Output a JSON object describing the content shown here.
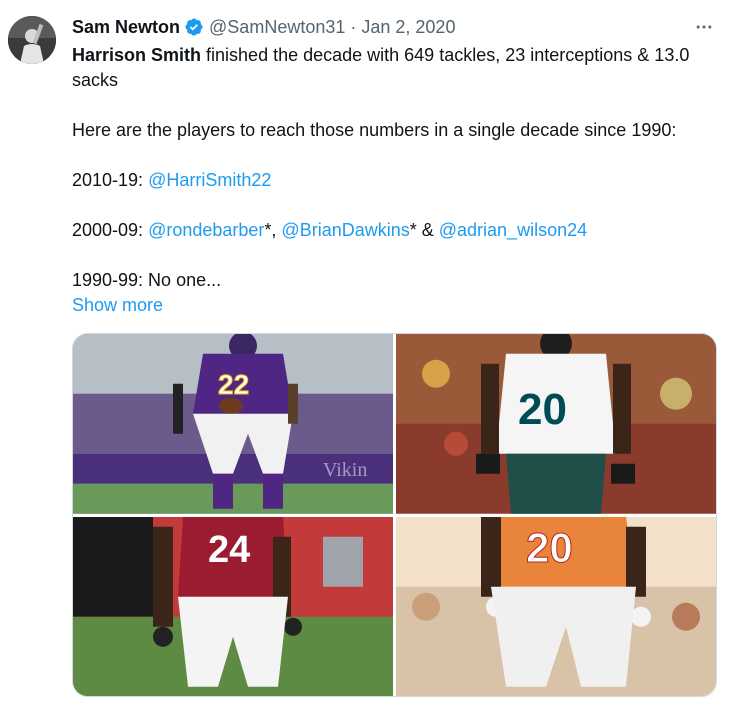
{
  "author": {
    "display_name": "Sam Newton",
    "handle": "@SamNewton31",
    "separator": "·",
    "date": "Jan 2, 2020",
    "verified_icon": "verified-badge-icon"
  },
  "menu_icon": "more-horizontal-icon",
  "tweet": {
    "p1_name": "Harrison Smith",
    "p1_rest": " finished the decade with 649 tackles, 23 interceptions & 13.0 sacks",
    "p2": "Here are the players to reach those numbers in a single decade since 1990:",
    "p3_prefix": "2010-19: ",
    "p3_mention": "@HarriSmith22",
    "p4_prefix": "2000-09: ",
    "p4_mention1": "@rondebarber",
    "p4_sep1": "*, ",
    "p4_mention2": "@BrianDawkins",
    "p4_sep2": "* & ",
    "p4_mention3": "@adrian_wilson24",
    "p5": "1990-99: No one...",
    "show_more": "Show more"
  },
  "media": [
    {
      "subject": "player in purple Vikings jersey number 22",
      "jersey_number": "22"
    },
    {
      "subject": "player in white Eagles jersey number 20",
      "jersey_number": "20"
    },
    {
      "subject": "player in red Cardinals jersey number 24",
      "jersey_number": "24"
    },
    {
      "subject": "player in orange Buccaneers jersey number 20",
      "jersey_number": "20"
    }
  ],
  "colors": {
    "link": "#1d9bf0",
    "secondary_text": "#536471",
    "verified": "#1d9bf0"
  }
}
